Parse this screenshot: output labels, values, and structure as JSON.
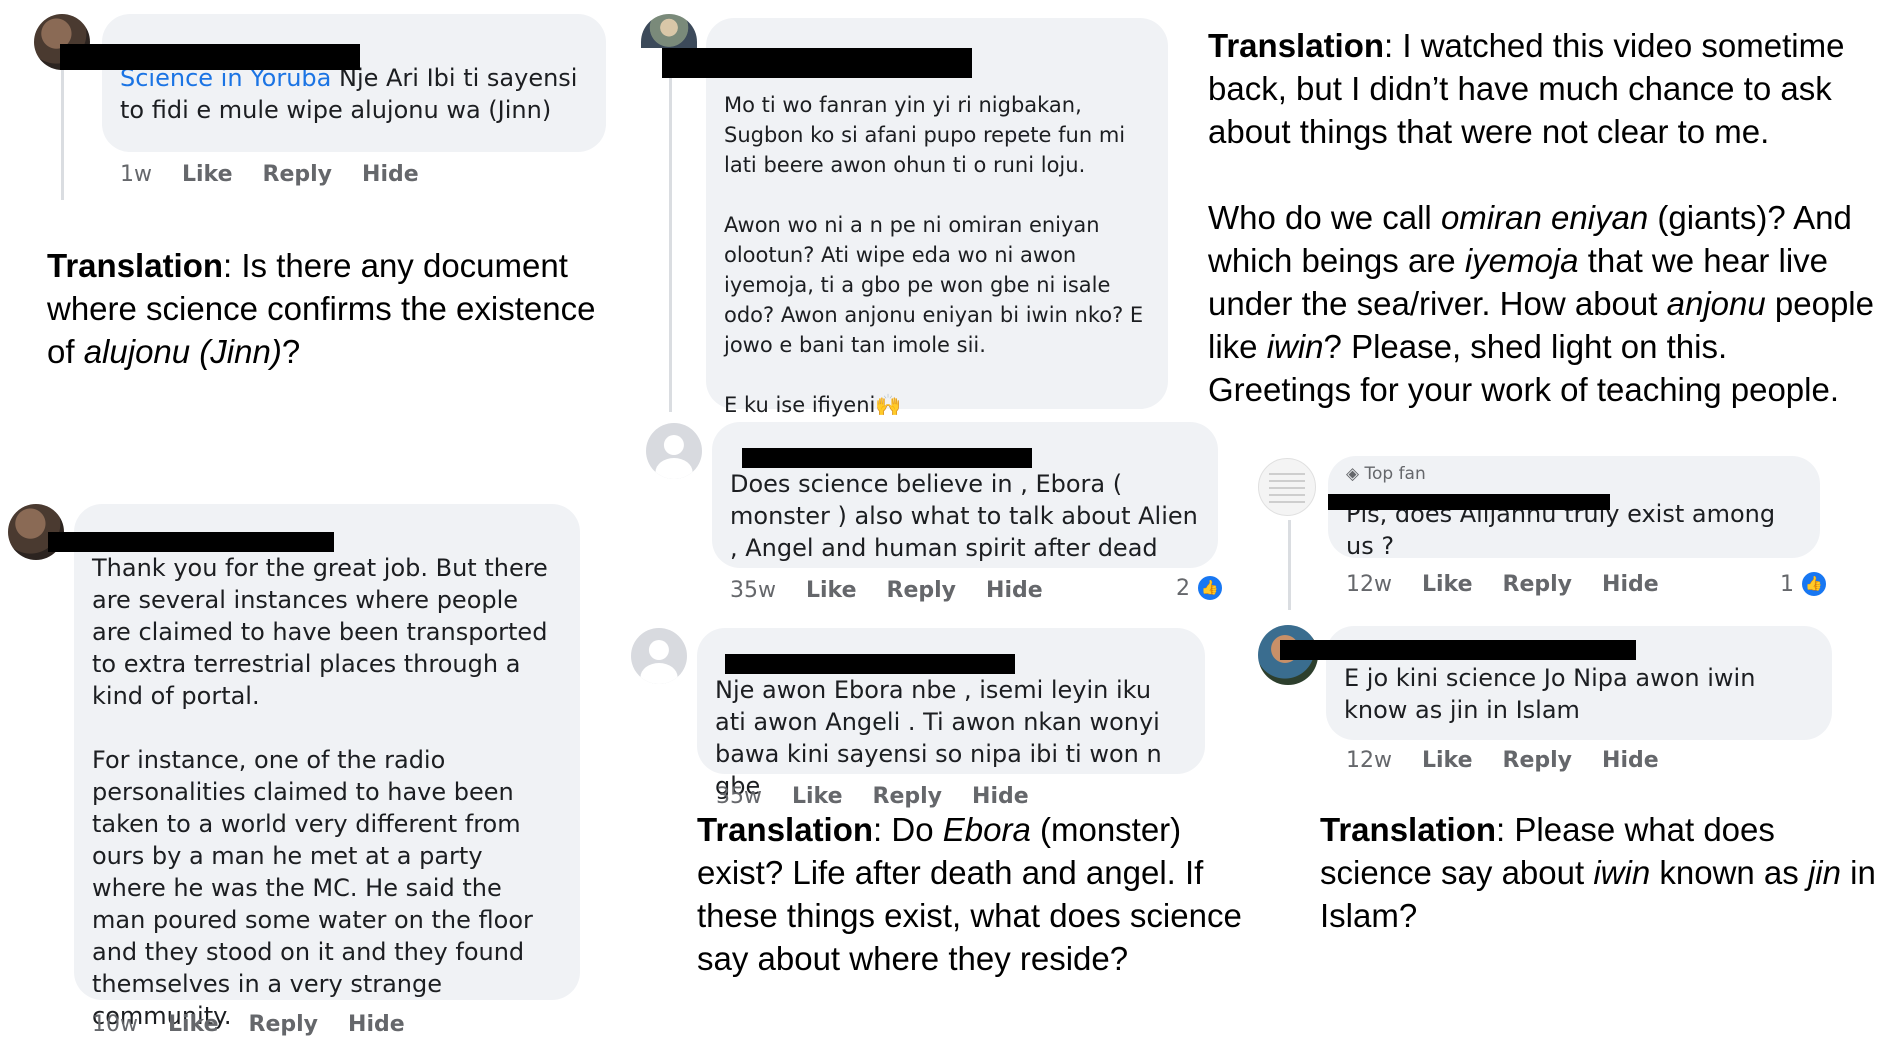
{
  "comments": {
    "c1": {
      "link_text": "Science in Yoruba",
      "text": " Nje Ari Ibi ti sayensi to fidi e mule wipe alujonu wa (Jinn)",
      "time": "1w",
      "like": "Like",
      "reply": "Reply",
      "hide": "Hide"
    },
    "c2": {
      "paragraphs": [
        "Mo ti wo fanran yin yi ri nigbakan, Sugbon ko si afani pupo repete fun mi lati beere awon ohun ti o runi loju.",
        "Awon wo ni a n pe ni omiran eniyan olootun? Ati wipe eda wo ni awon iyemoja, ti a gbo pe won gbe ni isale odo? Awon anjonu eniyan bi iwin nko? E jowo e bani tan imole sii.",
        "E ku ise ifiyeni🙌"
      ]
    },
    "c3": {
      "text": "Does science believe in  , Ebora ( monster ) also what to talk about Alien , Angel and human spirit after dead",
      "time": "35w",
      "like": "Like",
      "reply": "Reply",
      "hide": "Hide",
      "reaction_count": "2"
    },
    "c4": {
      "text": "Nje awon Ebora nbe , isemi leyin iku ati awon Angeli . Ti awon nkan wonyi bawa kini sayensi so nipa ibi ti won n gbe",
      "time": "35w",
      "like": "Like",
      "reply": "Reply",
      "hide": "Hide"
    },
    "c5": {
      "badge": "Top fan",
      "text": "Pls, does Alijannu truly exist among us ?",
      "time": "12w",
      "like": "Like",
      "reply": "Reply",
      "hide": "Hide",
      "reaction_count": "1"
    },
    "c6": {
      "text": "E jo kini science Jo Nipa awon iwin know as jin in Islam",
      "time": "12w",
      "like": "Like",
      "reply": "Reply",
      "hide": "Hide"
    },
    "c7": {
      "paragraphs": [
        "Thank you for the great job. But there are several instances where people are claimed to have been transported to extra terrestrial places through a kind of portal.",
        "For instance, one of the radio personalities claimed to have been taken to a world very different from ours by a man he met at a party where he was the MC. He said the man poured some water on the floor and they stood on it and they found themselves in a very strange community."
      ],
      "time": "10w",
      "like": "Like",
      "reply": "Reply",
      "hide": "Hide"
    }
  },
  "translations": {
    "label": "Translation",
    "t1": {
      "a": ": Is there any document where science confirms the existence of ",
      "i1": "alujonu (Jinn)",
      "b": "?"
    },
    "t2": {
      "p1": ": I watched this video sometime back, but I didn’t have much chance to ask about things that were not clear to me.",
      "a": "Who do we call ",
      "i1": "omiran eniyan",
      "b": " (giants)? And which beings are ",
      "i2": "iyemoja",
      "c": " that we hear live under the sea/river. How about ",
      "i3": "anjonu",
      "d": " people like ",
      "i4": "iwin",
      "e": "? Please, shed light on this. Greetings for your work of teaching people."
    },
    "t3": {
      "a": ": Do ",
      "i1": "Ebora",
      "b": " (monster) exist? Life after death and angel. If these things exist, what does science say about where they reside?"
    },
    "t4": {
      "a": ": Please what does science say about ",
      "i1": "iwin",
      "b": " known as ",
      "i2": "jin",
      "c": " in Islam?"
    }
  }
}
